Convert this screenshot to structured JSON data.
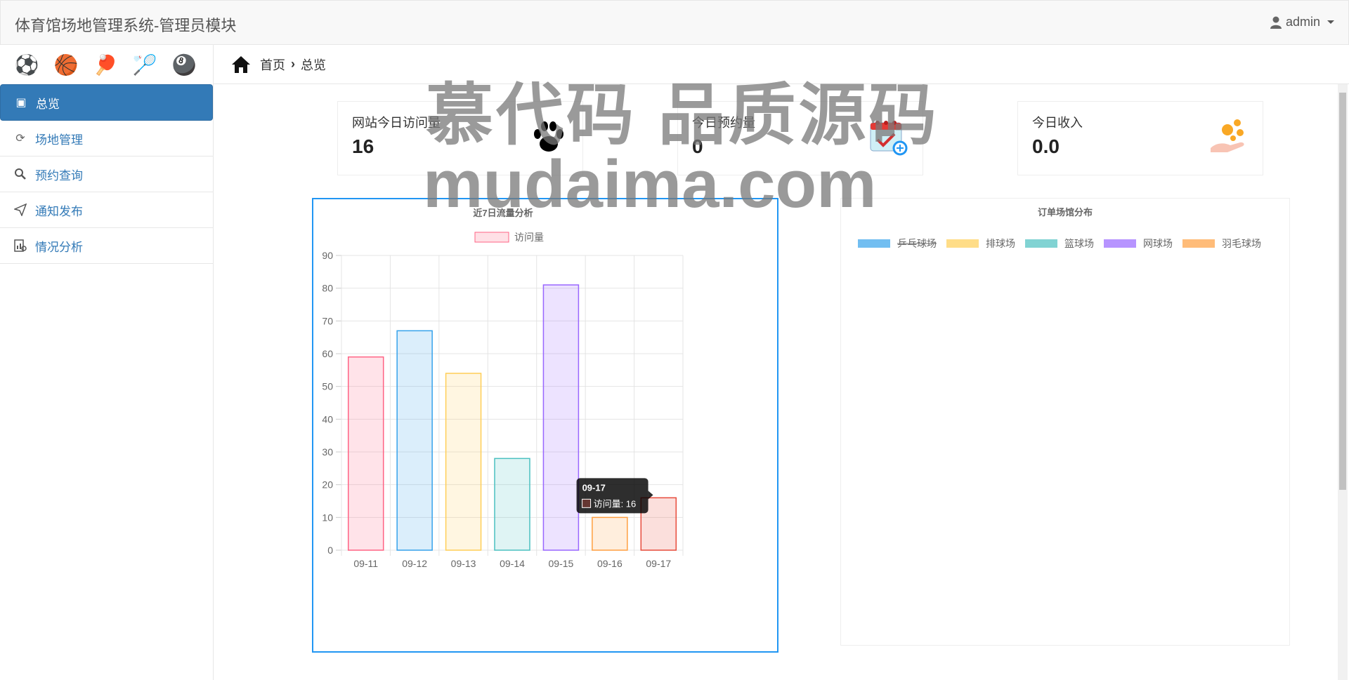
{
  "header": {
    "title": "体育馆场地管理系统-管理员模块",
    "user": "admin"
  },
  "sidebar": {
    "icons": [
      "soccer-ball-icon",
      "basketball-icon",
      "table-tennis-icon",
      "badminton-icon",
      "billiards-icon"
    ],
    "items": [
      {
        "label": "总览",
        "icon": "dashboard-icon"
      },
      {
        "label": "场地管理",
        "icon": "refresh-icon"
      },
      {
        "label": "预约查询",
        "icon": "search-icon"
      },
      {
        "label": "通知发布",
        "icon": "paper-plane-icon"
      },
      {
        "label": "情况分析",
        "icon": "analysis-icon"
      }
    ]
  },
  "breadcrumb": {
    "home": "首页",
    "current": "总览"
  },
  "cards": [
    {
      "label": "网站今日访问量",
      "value": "16",
      "icon": "paw-icon"
    },
    {
      "label": "今日预约量",
      "value": "0",
      "icon": "calendar-check-icon"
    },
    {
      "label": "今日收入",
      "value": "0.0",
      "icon": "coins-hand-icon"
    }
  ],
  "chart_data": [
    {
      "type": "bar",
      "title": "近7日流量分析",
      "categories": [
        "09-11",
        "09-12",
        "09-13",
        "09-14",
        "09-15",
        "09-16",
        "09-17"
      ],
      "series": [
        {
          "name": "访问量",
          "values": [
            59,
            67,
            54,
            28,
            81,
            10,
            16
          ]
        }
      ],
      "ylim": [
        0,
        90
      ],
      "yticks": [
        0,
        10,
        20,
        30,
        40,
        50,
        60,
        70,
        80,
        90
      ],
      "grid": true,
      "legend": "top",
      "colors": [
        "#ff6384",
        "#36a2eb",
        "#ffce56",
        "#4bc0c0",
        "#9966ff",
        "#ff9f40",
        "#e74c3c"
      ],
      "tooltip": {
        "title": "09-17",
        "text": "访问量: 16"
      }
    },
    {
      "type": "pie",
      "title": "订单场馆分布",
      "labels": [
        "乒乓球场",
        "排球场",
        "篮球场",
        "网球场",
        "羽毛球场"
      ],
      "values": [],
      "hidden": [
        "乒乓球场"
      ],
      "colors": [
        "#36a2eb",
        "#ffce56",
        "#4bc0c0",
        "#9966ff",
        "#ff9f40"
      ],
      "legend": "top"
    }
  ],
  "watermark": {
    "line1": "慕代码 品质源码",
    "line2": "mudaima.com"
  }
}
